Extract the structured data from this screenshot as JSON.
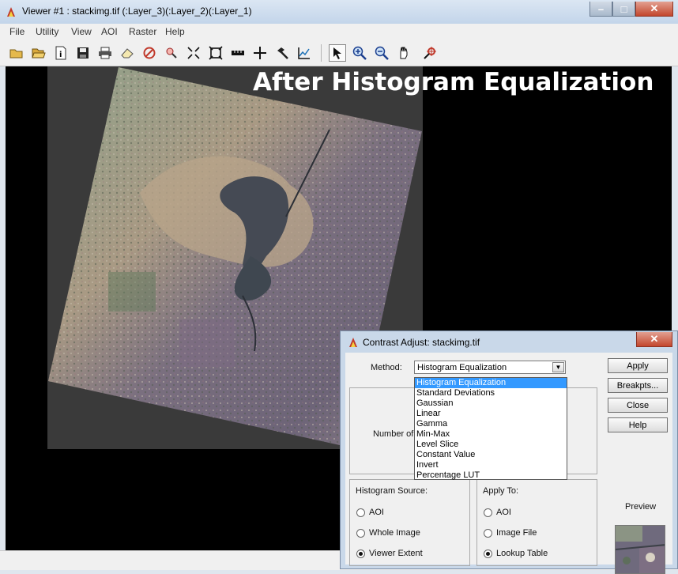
{
  "window": {
    "title": "Viewer #1 : stackimg.tif (:Layer_3)(:Layer_2)(:Layer_1)"
  },
  "window_controls": {
    "minimize": "–",
    "maximize": "□",
    "close": "✕"
  },
  "menu": [
    "File",
    "Utility",
    "View",
    "AOI",
    "Raster",
    "Help"
  ],
  "toolbar_icons": [
    "open-icon",
    "open-folder-icon",
    "info-icon",
    "save-icon",
    "print-icon",
    "eraser-icon",
    "no-entry-icon",
    "inquire-icon",
    "zoom-fit-icon",
    "expand-icon",
    "measure-icon",
    "crosshair-icon",
    "hammer-icon",
    "profile-icon",
    "pointer-icon",
    "zoom-in-icon",
    "zoom-out-icon",
    "pan-hand-icon",
    "inquire-cursor-icon"
  ],
  "overlay_title": "After Histogram Equalization",
  "dialog": {
    "title": "Contrast Adjust: stackimg.tif",
    "close": "✕",
    "method_label": "Method:",
    "method_value": "Histogram Equalization",
    "method_options": [
      "Histogram Equalization",
      "Standard Deviations",
      "Gaussian",
      "Linear",
      "Gamma",
      "Min-Max",
      "Level Slice",
      "Constant Value",
      "Invert",
      "Percentage LUT"
    ],
    "selected_option_index": 0,
    "partial_label": "Number of",
    "buttons": {
      "apply": "Apply",
      "breakpts": "Breakpts...",
      "close": "Close",
      "help": "Help"
    },
    "histogram_source": {
      "label": "Histogram Source:",
      "options": [
        "AOI",
        "Whole Image",
        "Viewer Extent"
      ],
      "selected": 2
    },
    "apply_to": {
      "label": "Apply To:",
      "options": [
        "AOI",
        "Image File",
        "Lookup Table"
      ],
      "selected": 2
    },
    "preview_label": "Preview"
  }
}
